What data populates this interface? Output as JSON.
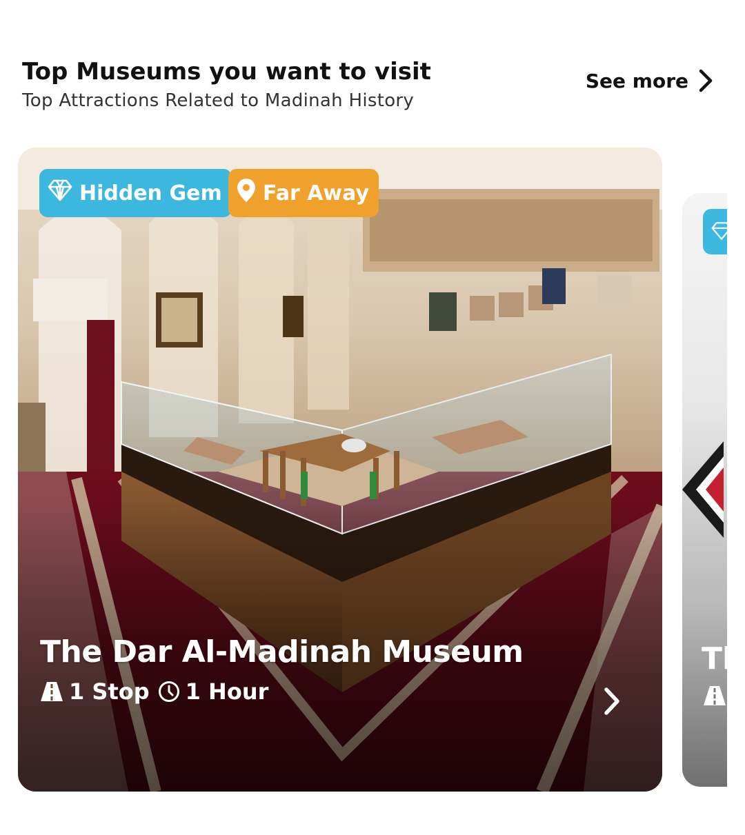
{
  "section": {
    "title": "Top Museums you want to visit",
    "subtitle": "Top Attractions Related to Madinah History",
    "see_more": "See more"
  },
  "cards": [
    {
      "title": "The Dar Al-Madinah Museum",
      "badges": [
        {
          "label": "Hidden Gem",
          "icon": "diamond-icon",
          "color": "#3cb8de"
        },
        {
          "label": "Far Away",
          "icon": "location-pin-icon",
          "color": "#f0a12b"
        }
      ],
      "stops": "1 Stop",
      "duration": "1 Hour",
      "stops_icon": "road-icon",
      "duration_icon": "clock-icon"
    },
    {
      "title": "Th",
      "badges": [
        {
          "label": "",
          "icon": "diamond-icon",
          "color": "#3cb8de"
        }
      ]
    }
  ],
  "colors": {
    "hidden_gem": "#3cb8de",
    "far_away": "#f0a12b",
    "carpet": "#7a1020"
  }
}
